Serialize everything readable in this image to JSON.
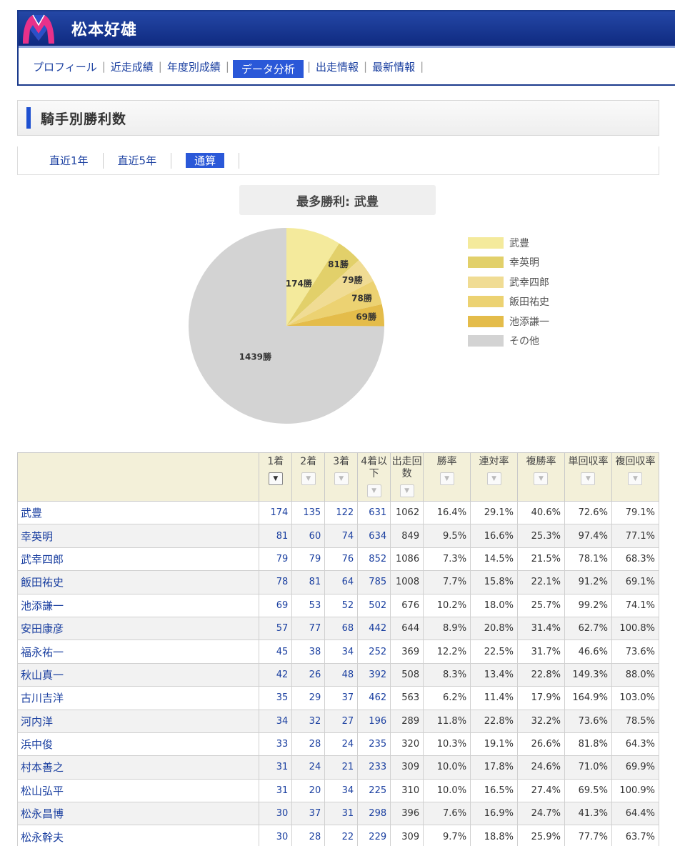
{
  "header": {
    "title": "松本好雄"
  },
  "nav": [
    "プロフィール",
    "近走成績",
    "年度別成績",
    "データ分析",
    "出走情報",
    "最新情報"
  ],
  "nav_active": "データ分析",
  "section": {
    "title": "騎手別勝利数"
  },
  "tabs": [
    "直近1年",
    "直近5年",
    "通算"
  ],
  "tab_active": "通算",
  "chart_data": {
    "type": "pie",
    "title": "最多勝利: 武豊",
    "slices": [
      {
        "label": "武豊",
        "value": 174,
        "text": "174勝",
        "color": "#f4ea9c"
      },
      {
        "label": "幸英明",
        "value": 81,
        "text": "81勝",
        "color": "#e2d06a"
      },
      {
        "label": "武幸四郎",
        "value": 79,
        "text": "79勝",
        "color": "#f0dc94"
      },
      {
        "label": "飯田祐史",
        "value": 78,
        "text": "78勝",
        "color": "#ecd272"
      },
      {
        "label": "池添謙一",
        "value": 69,
        "text": "69勝",
        "color": "#e4bc4a"
      },
      {
        "label": "その他",
        "value": 1439,
        "text": "1439勝",
        "color": "#d3d3d3"
      }
    ],
    "legend_position": "right"
  },
  "table": {
    "headers": [
      "",
      "1着",
      "2着",
      "3着",
      "4着以下",
      "出走回数",
      "勝率",
      "連対率",
      "複勝率",
      "単回収率",
      "複回収率"
    ],
    "rows": [
      [
        "武豊",
        "174",
        "135",
        "122",
        "631",
        "1062",
        "16.4%",
        "29.1%",
        "40.6%",
        "72.6%",
        "79.1%"
      ],
      [
        "幸英明",
        "81",
        "60",
        "74",
        "634",
        "849",
        "9.5%",
        "16.6%",
        "25.3%",
        "97.4%",
        "77.1%"
      ],
      [
        "武幸四郎",
        "79",
        "79",
        "76",
        "852",
        "1086",
        "7.3%",
        "14.5%",
        "21.5%",
        "78.1%",
        "68.3%"
      ],
      [
        "飯田祐史",
        "78",
        "81",
        "64",
        "785",
        "1008",
        "7.7%",
        "15.8%",
        "22.1%",
        "91.2%",
        "69.1%"
      ],
      [
        "池添謙一",
        "69",
        "53",
        "52",
        "502",
        "676",
        "10.2%",
        "18.0%",
        "25.7%",
        "99.2%",
        "74.1%"
      ],
      [
        "安田康彦",
        "57",
        "77",
        "68",
        "442",
        "644",
        "8.9%",
        "20.8%",
        "31.4%",
        "62.7%",
        "100.8%"
      ],
      [
        "福永祐一",
        "45",
        "38",
        "34",
        "252",
        "369",
        "12.2%",
        "22.5%",
        "31.7%",
        "46.6%",
        "73.6%"
      ],
      [
        "秋山真一",
        "42",
        "26",
        "48",
        "392",
        "508",
        "8.3%",
        "13.4%",
        "22.8%",
        "149.3%",
        "88.0%"
      ],
      [
        "古川吉洋",
        "35",
        "29",
        "37",
        "462",
        "563",
        "6.2%",
        "11.4%",
        "17.9%",
        "164.9%",
        "103.0%"
      ],
      [
        "河内洋",
        "34",
        "32",
        "27",
        "196",
        "289",
        "11.8%",
        "22.8%",
        "32.2%",
        "73.6%",
        "78.5%"
      ],
      [
        "浜中俊",
        "33",
        "28",
        "24",
        "235",
        "320",
        "10.3%",
        "19.1%",
        "26.6%",
        "81.8%",
        "64.3%"
      ],
      [
        "村本善之",
        "31",
        "24",
        "21",
        "233",
        "309",
        "10.0%",
        "17.8%",
        "24.6%",
        "71.0%",
        "69.9%"
      ],
      [
        "松山弘平",
        "31",
        "20",
        "34",
        "225",
        "310",
        "10.0%",
        "16.5%",
        "27.4%",
        "69.5%",
        "100.9%"
      ],
      [
        "松永昌博",
        "30",
        "37",
        "31",
        "298",
        "396",
        "7.6%",
        "16.9%",
        "24.7%",
        "41.3%",
        "64.4%"
      ],
      [
        "松永幹夫",
        "30",
        "28",
        "22",
        "229",
        "309",
        "9.7%",
        "18.8%",
        "25.9%",
        "77.7%",
        "63.7%"
      ]
    ]
  }
}
